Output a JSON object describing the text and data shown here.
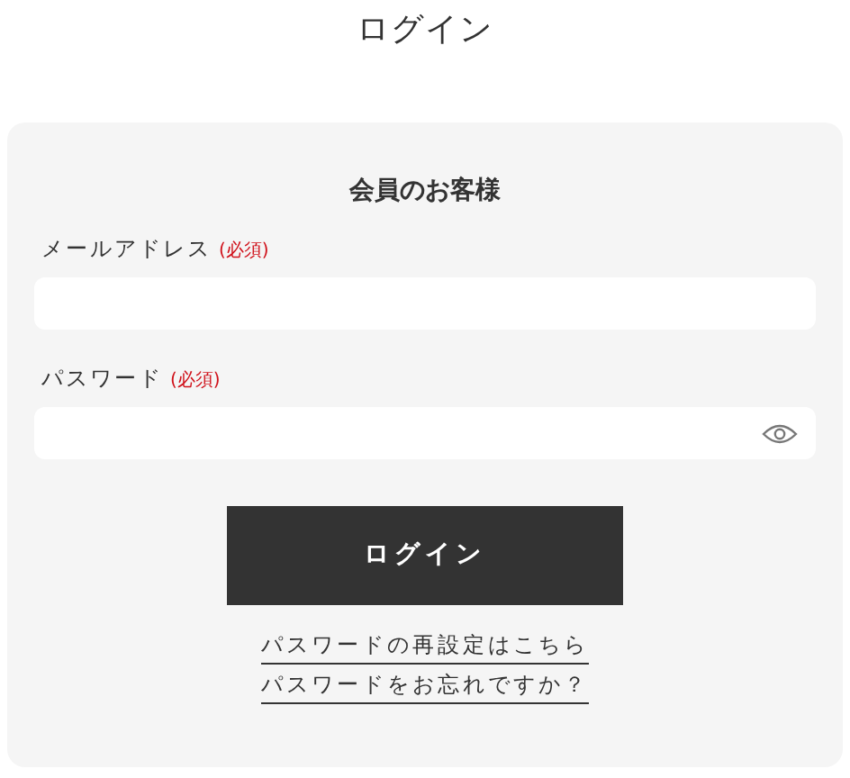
{
  "page_title": "ログイン",
  "card": {
    "heading": "会員のお客様",
    "fields": [
      {
        "kind": "text",
        "label": "メールアドレス",
        "required_mark": "(必須)"
      },
      {
        "kind": "password",
        "label": "パスワード",
        "required_mark": "(必須)"
      }
    ],
    "submit_button": "ログイン",
    "links": [
      "パスワードの再設定はこちら",
      "パスワードをお忘れですか？"
    ]
  }
}
